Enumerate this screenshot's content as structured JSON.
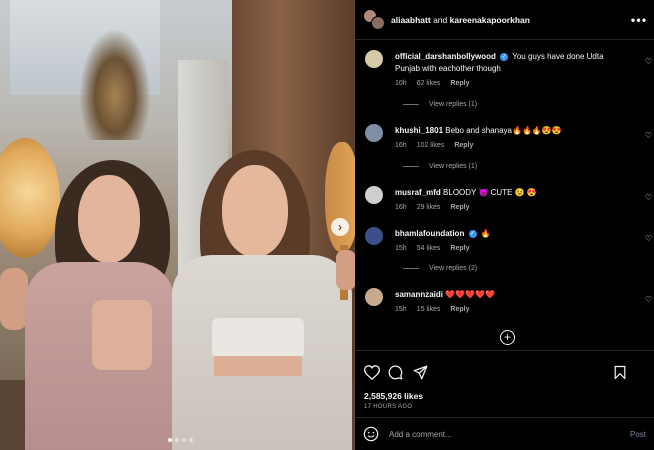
{
  "post": {
    "header": {
      "user1": "aliaabhatt",
      "and": "and",
      "user2": "kareenakapoorkhan",
      "more_icon": "more-horizontal-icon"
    },
    "carousel": {
      "total_images": 4,
      "active_index": 0,
      "next_icon": "chevron-right-icon"
    },
    "comments": [
      {
        "user": "official_darshanbollywood",
        "verified": true,
        "text": "You guys have done Udta Punjab with eachother though",
        "time": "10h",
        "likes": "62 likes",
        "reply": "Reply",
        "view_replies": "View replies (1)"
      },
      {
        "user": "khushi_1801",
        "verified": false,
        "text": "Bebo and shanaya🔥🔥🔥😍😍",
        "time": "16h",
        "likes": "102 likes",
        "reply": "Reply",
        "view_replies": "View replies (1)"
      },
      {
        "user": "musraf_mfd",
        "verified": false,
        "text": "BLOODY 😈 CUTE 😉 😍",
        "time": "16h",
        "likes": "29 likes",
        "reply": "Reply",
        "view_replies": ""
      },
      {
        "user": "bhamlafoundation",
        "verified": true,
        "text": "🔥",
        "time": "15h",
        "likes": "54 likes",
        "reply": "Reply",
        "view_replies": "View replies (2)"
      },
      {
        "user": "samannzaidi",
        "verified": false,
        "text": "❤️❤️❤️❤️❤️",
        "time": "15h",
        "likes": "15 likes",
        "reply": "Reply",
        "view_replies": ""
      }
    ],
    "load_more_icon": "plus-circle-icon",
    "likes_count": "2,585,926 likes",
    "time_ago": "17 HOURS AGO",
    "add_comment": {
      "placeholder": "Add a comment...",
      "post_label": "Post",
      "emoji_icon": "smiley-icon"
    },
    "actions": [
      "heart-icon",
      "comment-icon",
      "share-icon",
      "bookmark-icon"
    ],
    "colors": {
      "background": "#000000",
      "text": "#f5f5f5",
      "muted": "#a8a8a8",
      "verified": "#3897f0"
    }
  }
}
